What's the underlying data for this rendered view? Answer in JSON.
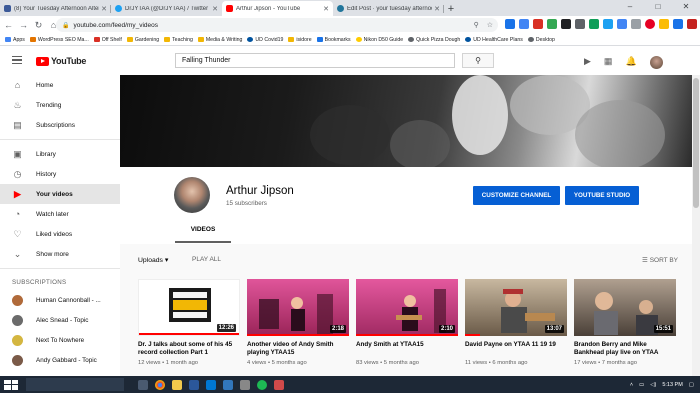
{
  "browser": {
    "tabs": [
      {
        "title": "(8) Your Tuesday Afternoon Altern",
        "favicon_color": "#3b5998",
        "active": false
      },
      {
        "title": "DrJYTAA (@DrJYTAA) / Twitter",
        "favicon_color": "#1da1f2",
        "active": false
      },
      {
        "title": "Arthur Jipson - YouTube",
        "favicon_color": "#ff0000",
        "active": true
      },
      {
        "title": "Edit Post · your tuesday afternoon",
        "favicon_color": "#21759b",
        "active": false
      }
    ],
    "new_tab": "+",
    "window_controls": [
      "–",
      "□",
      "✕"
    ],
    "url": "youtube.com/feed/my_videos",
    "bookmarks": [
      {
        "label": "Apps",
        "color": "#4285f4"
      },
      {
        "label": "WordPress SEO Ma...",
        "color": "#e37400"
      },
      {
        "label": "Off Shelf",
        "color": "#d93025"
      },
      {
        "label": "Gardening",
        "color": "#f2b705"
      },
      {
        "label": "Teaching",
        "color": "#f2b705"
      },
      {
        "label": "Media & Writing",
        "color": "#f2b705"
      },
      {
        "label": "UD Covid19",
        "color": "#00539f"
      },
      {
        "label": "isidore",
        "color": "#f2b705"
      },
      {
        "label": "Bookmarks",
        "color": "#1a73e8"
      },
      {
        "label": "Nikon D50 Guide",
        "color": "#ffcc00"
      },
      {
        "label": "Quick Pizza Dough",
        "color": "#5f6368"
      },
      {
        "label": "UD HealthCare Plans",
        "color": "#00539f"
      },
      {
        "label": "Desktop",
        "color": "#5f6368"
      }
    ]
  },
  "youtube": {
    "logo": "YouTube",
    "search_value": "Falling Thunder",
    "sidebar": {
      "items": [
        {
          "label": "Home",
          "icon": "home-icon",
          "glyph": "⌂",
          "active": false
        },
        {
          "label": "Trending",
          "icon": "trending-icon",
          "glyph": "🔥",
          "active": false
        },
        {
          "label": "Subscriptions",
          "icon": "subscriptions-icon",
          "glyph": "▤",
          "active": false
        },
        {
          "label": "Library",
          "icon": "library-icon",
          "glyph": "▶",
          "active": false
        },
        {
          "label": "History",
          "icon": "history-icon",
          "glyph": "◷",
          "active": false
        },
        {
          "label": "Your videos",
          "icon": "your-videos-icon",
          "glyph": "▶",
          "active": true
        },
        {
          "label": "Watch later",
          "icon": "watch-later-icon",
          "glyph": "◔",
          "active": false
        },
        {
          "label": "Liked videos",
          "icon": "liked-videos-icon",
          "glyph": "👍",
          "active": false
        },
        {
          "label": "Show more",
          "icon": "chevron-down-icon",
          "glyph": "⌄",
          "active": false
        }
      ],
      "subscriptions_heading": "SUBSCRIPTIONS",
      "subscriptions": [
        {
          "label": "Human Cannonball - ...",
          "color": "#b06a3a"
        },
        {
          "label": "Alec Snead - Topic",
          "color": "#6b6b6b"
        },
        {
          "label": "Next To Nowhere",
          "color": "#d4b640"
        },
        {
          "label": "Andy Gabbard - Topic",
          "color": "#7a5a48"
        }
      ]
    },
    "channel": {
      "name": "Arthur Jipson",
      "subscribers": "15 subscribers",
      "customize_button": "CUSTOMIZE CHANNEL",
      "studio_button": "YOUTUBE STUDIO",
      "tab": "VIDEOS"
    },
    "uploads": {
      "label": "Uploads",
      "play_all": "PLAY ALL",
      "sort_by": "SORT BY"
    },
    "videos": [
      {
        "title": "Dr. J talks about some of his 45 record collection Part 1",
        "duration": "12:26",
        "meta": "12 views • 1 month ago",
        "thumb_bg": "#ffffff",
        "watched": 1.0
      },
      {
        "title": "Another video of Andy Smith playing YTAA15",
        "duration": "2:18",
        "meta": "4 views • 5 months ago",
        "thumb_bg": "#b8306a",
        "watched": 1.0
      },
      {
        "title": "Andy Smith at YTAA15",
        "duration": "2:10",
        "meta": "83 views • 5 months ago",
        "thumb_bg": "#c0306c",
        "watched": 1.0
      },
      {
        "title": "David Payne on YTAA 11 19 19",
        "duration": "13:07",
        "meta": "11 views • 6 months ago",
        "thumb_bg": "#a08868",
        "watched": 0.15
      },
      {
        "title": "Brandon Berry and Mike Bankhead play live on YTAA",
        "duration": "15:51",
        "meta": "17 views • 7 months ago",
        "thumb_bg": "#8a7a6a",
        "watched": 0.0
      }
    ]
  },
  "taskbar": {
    "search": "",
    "time": "5:13 PM"
  }
}
